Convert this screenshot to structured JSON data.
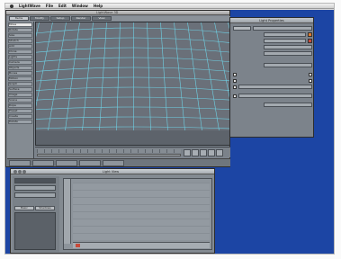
{
  "menubar": {
    "app_name": "LightWave",
    "items": [
      "File",
      "Edit",
      "Window",
      "Help"
    ]
  },
  "main_window": {
    "title": "LightWave 3D",
    "tabs": [
      "Items",
      "Modify",
      "Setup",
      "Render",
      "View"
    ],
    "tools": [
      "Move",
      "Rotate",
      "Size",
      "Stretch",
      "Add",
      "Clone",
      "Lights",
      "Camera",
      "Objects",
      "Bones",
      "Motion",
      "Graph",
      "Surface",
      "Image",
      "Scene",
      "Dope",
      "Preset",
      "Create",
      "Delete"
    ]
  },
  "light_properties": {
    "title": "Light Properties"
  },
  "light_view": {
    "title": "Light View",
    "tabs": [
      "Basic",
      "Shadows"
    ]
  },
  "colors": {
    "desktop": "#1c45a4",
    "grid_line": "#6fd2e6",
    "ui_gray": "#7f8790"
  }
}
